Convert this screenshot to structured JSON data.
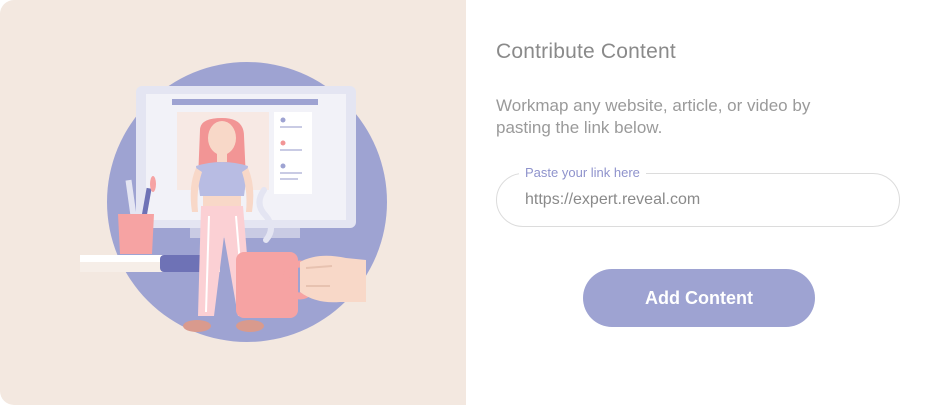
{
  "dialog": {
    "title": "Contribute Content",
    "description": "Workmap any website, article, or video by pasting the link below.",
    "link_field": {
      "label": "Paste your link here",
      "value": "https://expert.reveal.com"
    },
    "add_button_label": "Add Content"
  },
  "illustration": {
    "name": "woman-with-coffee-illustration",
    "colors": {
      "background": "#f3e8e0",
      "circle": "#9ea3d2",
      "hair": "#f29595",
      "cup": "#f6a3a3",
      "accent": "#6e72b6"
    }
  },
  "colors": {
    "accent": "#9ea3d2",
    "label": "#8f93cc",
    "text": "#8a8a8a"
  }
}
